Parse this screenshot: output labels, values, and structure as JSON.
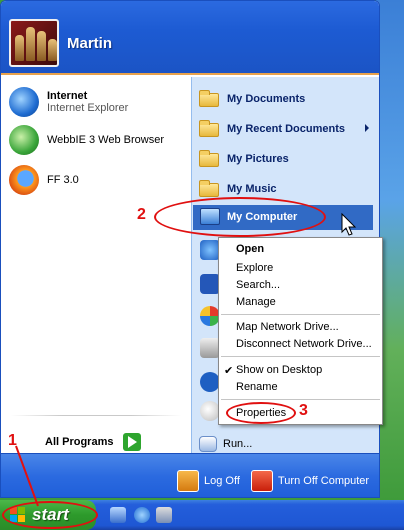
{
  "user": {
    "name": "Martin"
  },
  "pinned": [
    {
      "title": "Internet",
      "subtitle": "Internet Explorer",
      "icon": "internet-explorer-icon"
    },
    {
      "title": "WebbIE 3 Web Browser",
      "icon": "webbie-icon"
    },
    {
      "title": "FF 3.0",
      "icon": "firefox-icon"
    }
  ],
  "all_programs": {
    "label": "All Programs",
    "icon": "green-arrow-icon"
  },
  "places": [
    {
      "label": "My Documents",
      "icon": "folder-icon"
    },
    {
      "label": "My Recent Documents",
      "icon": "folder-icon"
    },
    {
      "label": "My Pictures",
      "icon": "folder-icon"
    },
    {
      "label": "My Music",
      "icon": "folder-icon"
    },
    {
      "label": "My Computer",
      "icon": "computer-icon"
    }
  ],
  "run": {
    "label": "Run..."
  },
  "footer": {
    "logoff_label": "Log Off",
    "turnoff_label": "Turn Off Computer"
  },
  "start": {
    "label": "start"
  },
  "context_menu": {
    "open": "Open",
    "explore": "Explore",
    "search": "Search...",
    "manage": "Manage",
    "map_drive": "Map Network Drive...",
    "disconnect_drive": "Disconnect Network Drive...",
    "show_desktop": "Show on Desktop",
    "rename": "Rename",
    "properties": "Properties"
  },
  "annotations": {
    "step1": "1",
    "step2": "2",
    "step3": "3",
    "color": "#e01010"
  },
  "colors": {
    "highlight": "#316ac5",
    "taskbar": "#245edb",
    "start_button": "#2d9a2b"
  }
}
